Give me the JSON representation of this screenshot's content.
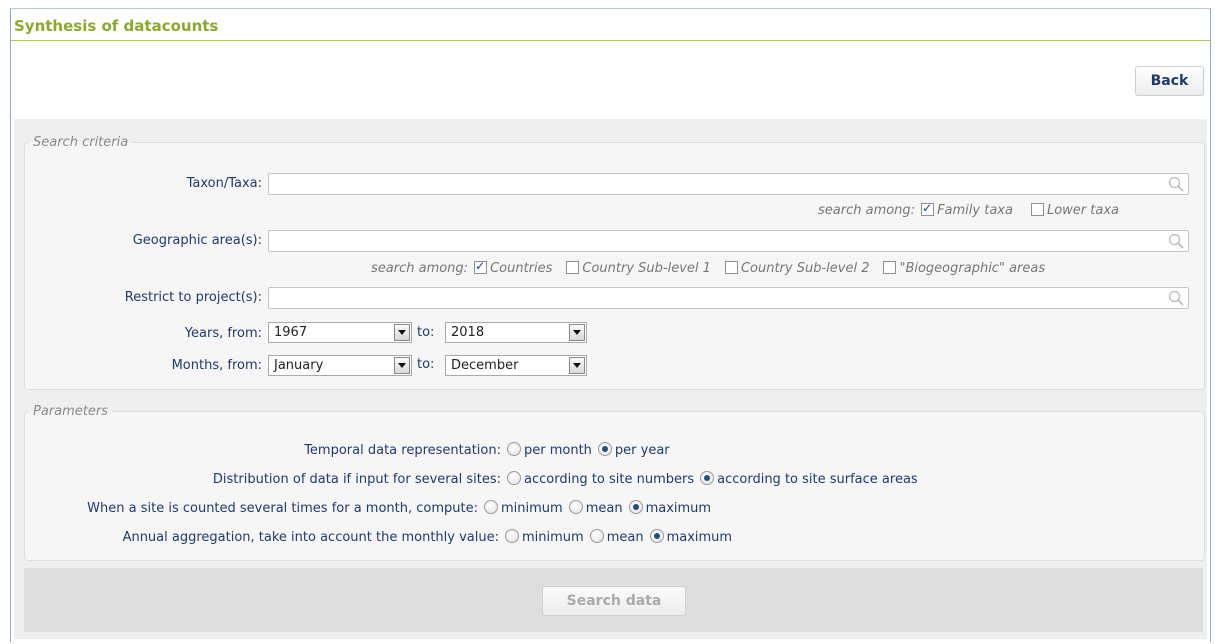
{
  "page_title": "Synthesis of datacounts",
  "back_label": "Back",
  "search_criteria": {
    "legend": "Search criteria",
    "taxon_label": "Taxon/Taxa:",
    "taxon_value": "",
    "taxon_search_among": "search among:",
    "taxon_options": [
      {
        "label": "Family taxa",
        "checked": true
      },
      {
        "label": "Lower taxa",
        "checked": false
      }
    ],
    "geo_label": "Geographic area(s):",
    "geo_value": "",
    "geo_search_among": "search among:",
    "geo_options": [
      {
        "label": "Countries",
        "checked": true
      },
      {
        "label": "Country Sub-level 1",
        "checked": false
      },
      {
        "label": "Country Sub-level 2",
        "checked": false
      },
      {
        "label": "\"Biogeographic\" areas",
        "checked": false
      }
    ],
    "project_label": "Restrict to project(s):",
    "project_value": "",
    "years_label": "Years, from:",
    "year_from": "1967",
    "to_label": "to:",
    "year_to": "2018",
    "months_label": "Months, from:",
    "month_from": "January",
    "month_to": "December"
  },
  "parameters": {
    "legend": "Parameters",
    "rows": [
      {
        "label": "Temporal data representation:",
        "options": [
          {
            "label": "per month",
            "selected": false
          },
          {
            "label": "per year",
            "selected": true
          }
        ]
      },
      {
        "label": "Distribution of data if input for several sites:",
        "options": [
          {
            "label": "according to site numbers",
            "selected": false
          },
          {
            "label": "according to site surface areas",
            "selected": true
          }
        ]
      },
      {
        "label": "When a site is counted several times for a month, compute:",
        "options": [
          {
            "label": "minimum",
            "selected": false
          },
          {
            "label": "mean",
            "selected": false
          },
          {
            "label": "maximum",
            "selected": true
          }
        ]
      },
      {
        "label": "Annual aggregation, take into account the monthly value:",
        "options": [
          {
            "label": "minimum",
            "selected": false
          },
          {
            "label": "mean",
            "selected": false
          },
          {
            "label": "maximum",
            "selected": true
          }
        ]
      }
    ]
  },
  "search_button_label": "Search data",
  "colors": {
    "title": "#8aaa2a",
    "text": "#1f3a6e",
    "panel": "#efefef"
  }
}
